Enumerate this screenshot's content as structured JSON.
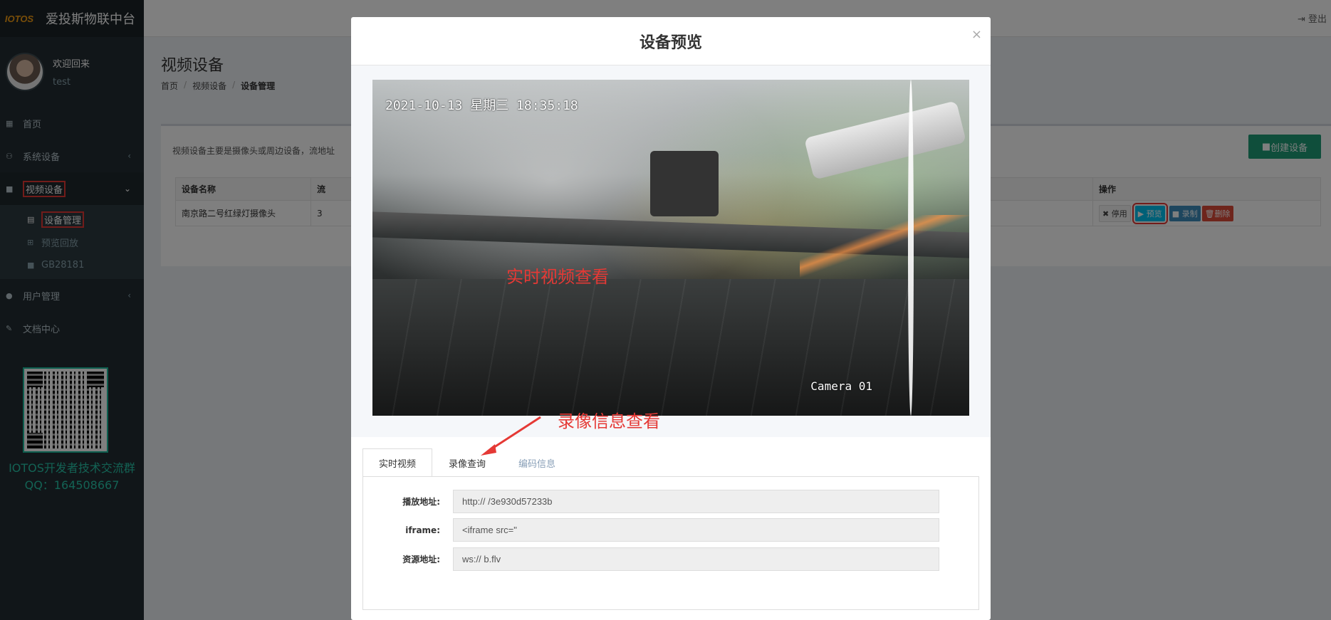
{
  "brand": {
    "logo_text": "IOTOS",
    "name": "爱投斯物联中台"
  },
  "user": {
    "welcome": "欢迎回来",
    "name": "test"
  },
  "sidebar": {
    "items": [
      {
        "label": "首页",
        "icon": "dashboard-icon"
      },
      {
        "label": "系统设备",
        "icon": "sitemap-icon"
      },
      {
        "label": "视频设备",
        "icon": "video-camera-icon"
      },
      {
        "label": "用户管理",
        "icon": "user-icon"
      },
      {
        "label": "文档中心",
        "icon": "edit-icon"
      }
    ],
    "video_sub": [
      {
        "label": "设备管理",
        "icon": "file-icon"
      },
      {
        "label": "预览回放",
        "icon": "plus-square-icon"
      },
      {
        "label": "GB28181",
        "icon": "video-camera-icon"
      }
    ]
  },
  "qr_caption": {
    "line1": "IOTOS开发者技术交流群",
    "line2": "QQ：164508667"
  },
  "topbar": {
    "logout": "登出"
  },
  "page": {
    "title": "视频设备",
    "breadcrumb": [
      "首页",
      "视频设备",
      "设备管理"
    ],
    "description": "视频设备主要是摄像头或周边设备，流地址",
    "create_button": "创建设备"
  },
  "table": {
    "headers": [
      "设备名称",
      "流",
      "操作"
    ],
    "rows": [
      {
        "name": "南京路二号红绿灯摄像头",
        "stream": "3"
      }
    ],
    "ops": {
      "stop": "停用",
      "preview": "预览",
      "record": "录制",
      "delete": "删除"
    }
  },
  "modal": {
    "title": "设备预览",
    "close": "×",
    "osd_time": "2021-10-13 星期三 18:35:18",
    "osd_camera": "Camera 01",
    "annotation_live": "实时视频查看",
    "annotation_record": "录像信息查看",
    "tabs": [
      "实时视频",
      "录像查询",
      "编码信息"
    ],
    "fields": [
      {
        "label": "播放地址:",
        "value": "http://                                                                            /3e930d57233b"
      },
      {
        "label": "iframe:",
        "value": "<iframe src=\""
      },
      {
        "label": "资源地址:",
        "value": "ws://                                               b.flv"
      }
    ]
  }
}
